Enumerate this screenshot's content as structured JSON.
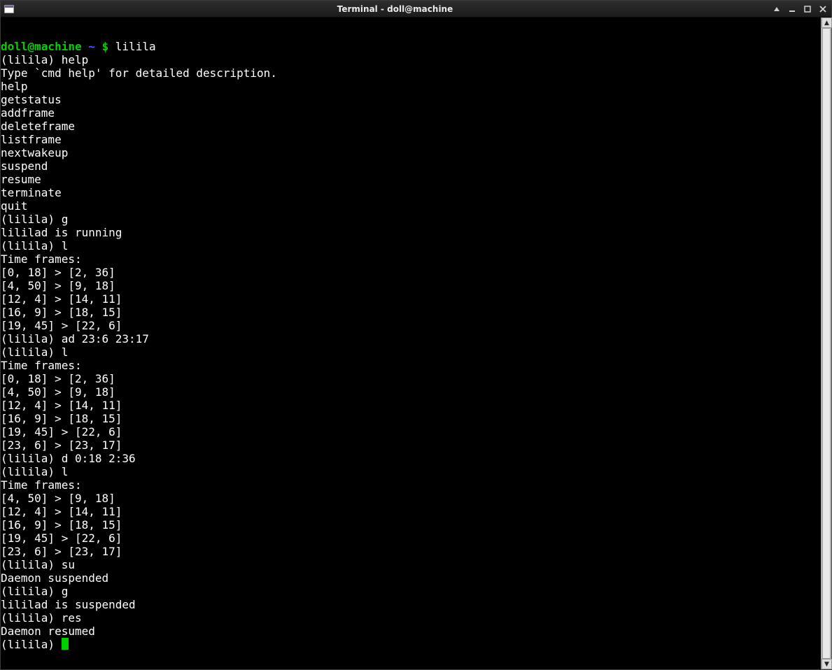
{
  "window": {
    "title": "Terminal - doll@machine"
  },
  "prompt": {
    "user": "doll@machine",
    "path": "~",
    "dollar": "$",
    "cmd": "lilila"
  },
  "repl_prompt": "(lilila) ",
  "lines": {
    "l0_cmd": "help",
    "l1": "Type `cmd help' for detailed description.",
    "blank": "",
    "h1": "help",
    "h2": "getstatus",
    "h3": "addframe",
    "h4": "deleteframe",
    "h5": "listframe",
    "h6": "nextwakeup",
    "h7": "suspend",
    "h8": "resume",
    "h9": "terminate",
    "h10": "quit",
    "c_g": "g",
    "r_g": "lililad is running",
    "c_l": "l",
    "tf_hdr": "Time frames:",
    "tf_a1": "[0, 18] > [2, 36]",
    "tf_a2": "[4, 50] > [9, 18]",
    "tf_a3": "[12, 4] > [14, 11]",
    "tf_a4": "[16, 9] > [18, 15]",
    "tf_a5": "[19, 45] > [22, 6]",
    "c_ad": "ad 23:6 23:17",
    "tf_b6": "[23, 6] > [23, 17]",
    "c_d": "d 0:18 2:36",
    "c_su": "su",
    "r_su": "Daemon suspended",
    "r_g2": "lililad is suspended",
    "c_res": "res",
    "r_res": "Daemon resumed"
  }
}
